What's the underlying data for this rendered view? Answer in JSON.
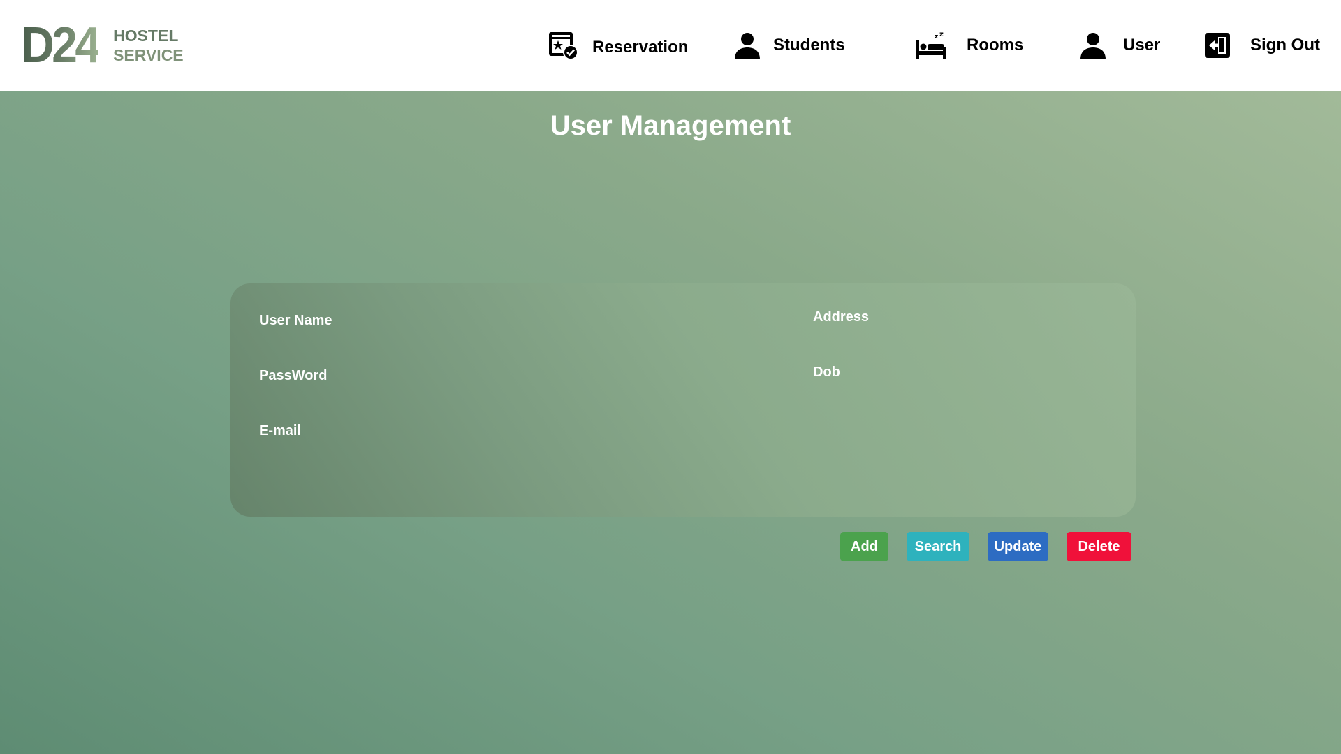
{
  "brand": {
    "mark": "D24",
    "line1": "HOSTEL",
    "line2": "SERVICE"
  },
  "nav": {
    "items": [
      {
        "label": "Reservation",
        "icon": "calendar-check-icon"
      },
      {
        "label": "Students",
        "icon": "person-icon"
      },
      {
        "label": "Rooms",
        "icon": "bed-icon"
      },
      {
        "label": "User",
        "icon": "person-icon"
      },
      {
        "label": "Sign Out",
        "icon": "sign-out-icon"
      }
    ]
  },
  "page": {
    "title": "User Management"
  },
  "form": {
    "labels": {
      "user_name": "User Name",
      "password": "PassWord",
      "email": "E-mail",
      "address": "Address",
      "dob": "Dob"
    }
  },
  "actions": {
    "add": "Add",
    "search": "Search",
    "update": "Update",
    "delete": "Delete"
  },
  "colors": {
    "add": "#4ba24d",
    "search": "#2eb2bd",
    "update": "#2d6cc2",
    "delete": "#f0113a",
    "background_start": "#5e8c73",
    "background_end": "#a2ba99"
  }
}
